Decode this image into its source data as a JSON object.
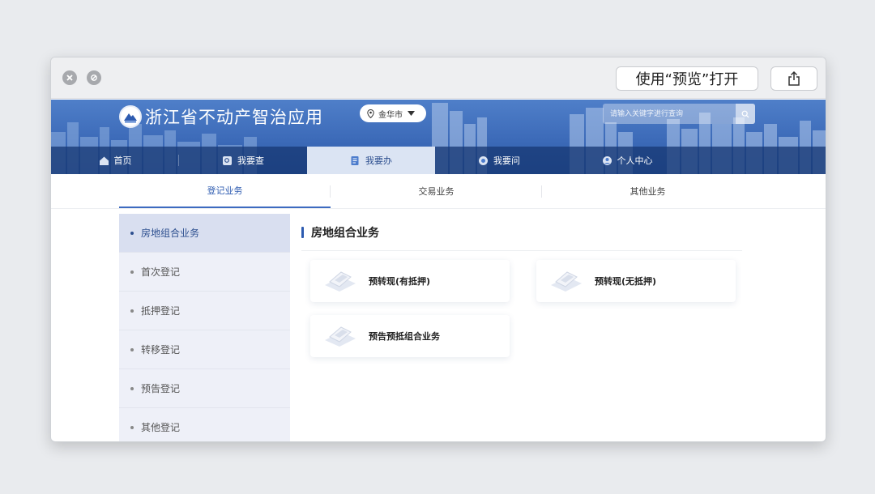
{
  "window": {
    "preview_button": "使用“预览”打开"
  },
  "header": {
    "site_title": "浙江省不动产智治应用",
    "city": "金华市",
    "search_placeholder": "请输入关键字进行查询"
  },
  "nav": {
    "items": [
      {
        "label": "首页",
        "icon": "home-icon"
      },
      {
        "label": "我要查",
        "icon": "search-doc-icon"
      },
      {
        "label": "我要办",
        "icon": "handle-icon"
      },
      {
        "label": "我要问",
        "icon": "question-icon"
      },
      {
        "label": "个人中心",
        "icon": "user-icon"
      }
    ],
    "active_index": 2
  },
  "tabs": [
    {
      "label": "登记业务"
    },
    {
      "label": "交易业务"
    },
    {
      "label": "其他业务"
    }
  ],
  "sidebar": {
    "items": [
      {
        "label": "房地组合业务"
      },
      {
        "label": "首次登记"
      },
      {
        "label": "抵押登记"
      },
      {
        "label": "转移登记"
      },
      {
        "label": "预告登记"
      },
      {
        "label": "其他登记"
      }
    ],
    "active_index": 0
  },
  "content": {
    "title": "房地组合业务",
    "cards": [
      {
        "label": "预转现(有抵押)"
      },
      {
        "label": "预转现(无抵押)"
      },
      {
        "label": "预告预抵组合业务"
      }
    ]
  },
  "colors": {
    "accent": "#2d5bb0",
    "banner": "#3c6ab8",
    "nav_active_bg": "#dbe4f3"
  }
}
